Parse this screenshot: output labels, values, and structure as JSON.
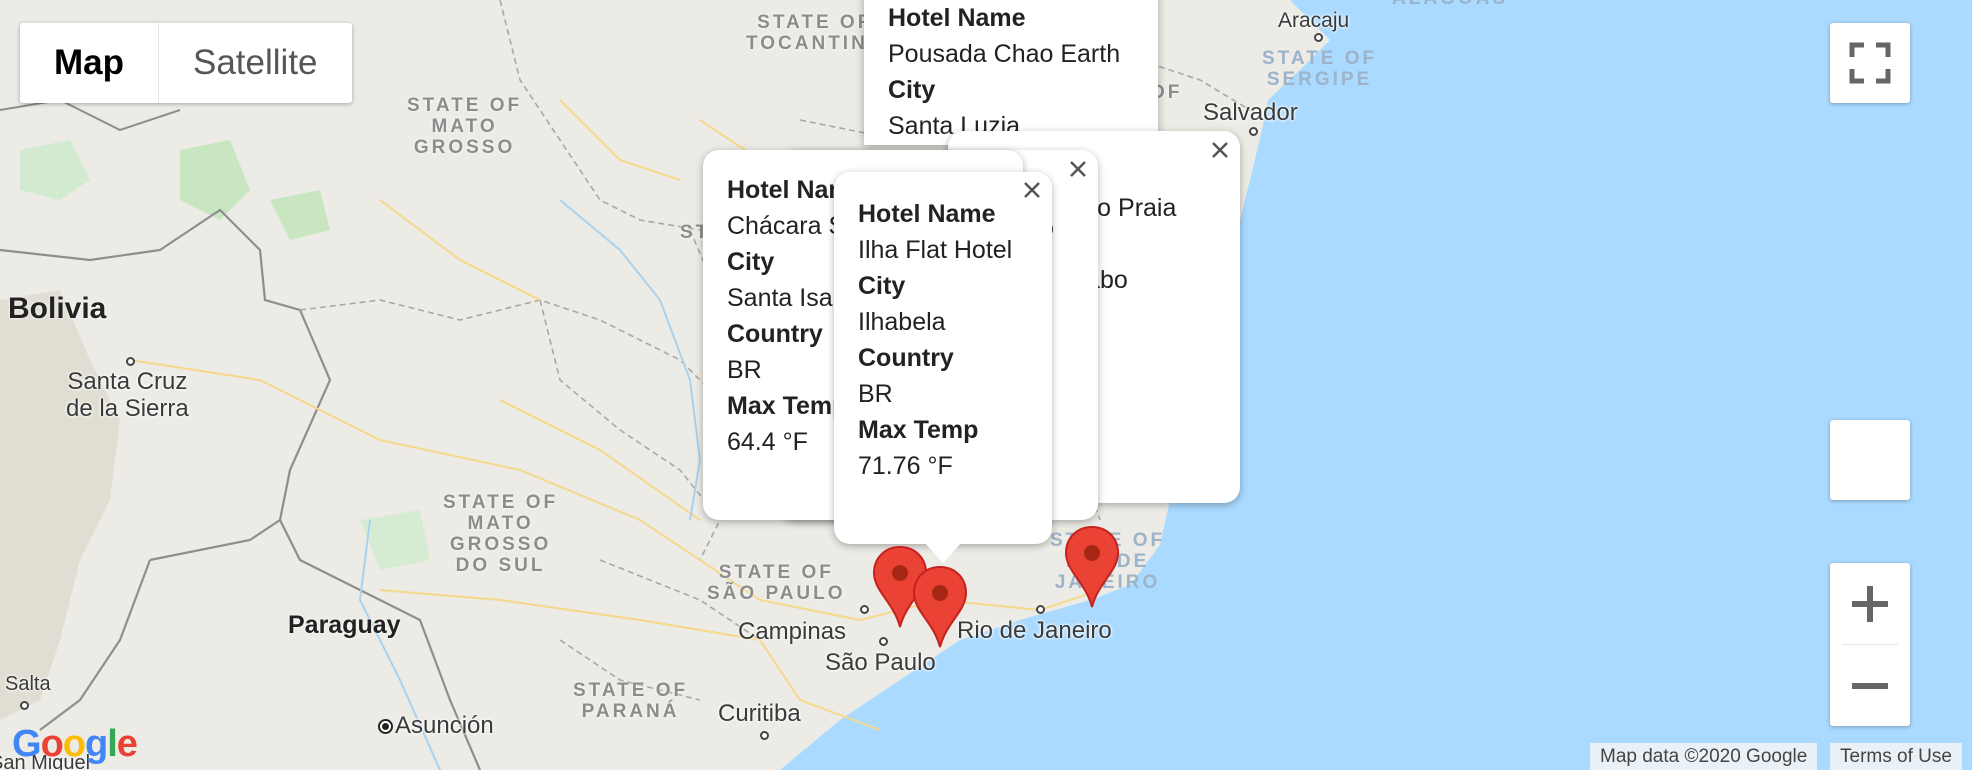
{
  "map_type": {
    "map_label": "Map",
    "satellite_label": "Satellite",
    "active": "Map"
  },
  "countries": {
    "bolivia": "Bolivia",
    "paraguay": "Paraguay"
  },
  "states": {
    "tocantins": [
      "STATE OF",
      "TOCANTINS"
    ],
    "mato_grosso": [
      "STATE OF",
      "MATO",
      "GROSSO"
    ],
    "mato_grosso_do_sul": [
      "STATE OF",
      "MATO",
      "GROSSO",
      "DO SUL"
    ],
    "sao_paulo": [
      "STATE OF",
      "SÃO PAULO"
    ],
    "parana": [
      "STATE OF",
      "PARANÁ"
    ],
    "sergipe": [
      "STATE OF",
      "SERGIPE"
    ],
    "rio_de_janeiro": [
      "STATE OF",
      "RIO DE",
      "JANEIRO"
    ],
    "alagoas": "ALAGOAS",
    "bahia_fragment": "OF"
  },
  "cities": {
    "santa_cruz": [
      "Santa Cruz",
      "de la Sierra"
    ],
    "salta": "Salta",
    "san_miguel": "San Miguel",
    "asuncion": "Asunción",
    "campinas": "Campinas",
    "sao_paulo": "São Paulo",
    "rio_de_janeiro": "Rio de Janeiro",
    "curitiba": "Curitiba",
    "aracaju": "Aracaju",
    "salvador": "Salvador"
  },
  "info_windows": [
    {
      "hotel_label": "Hotel Name",
      "hotel": "Pousada Chao Earth",
      "city_label": "City",
      "city": "Santa Luzia"
    },
    {
      "hotel_label": "Hotel Name",
      "hotel_fragment": "orto Praia",
      "city_fragment": "Cabo",
      "hotel_label_fragment": "e",
      "line2_fragment": "o"
    },
    {
      "hotel_label": "Hotel Name",
      "hotel": "Chácara S",
      "city_label": "City",
      "city": "Santa Isa",
      "country_label": "Country",
      "country": "BR",
      "temp_label": "Max Temp",
      "temp": "64.4 °F"
    },
    {
      "hotel_label": "Hotel Name",
      "hotel": "Ilha Flat Hotel",
      "city_label": "City",
      "city": "Ilhabela",
      "country_label": "Country",
      "country": "BR",
      "temp_label": "Max Temp",
      "temp": "71.76 °F"
    }
  ],
  "markers": [
    {
      "label": "Ilha Flat Hotel marker"
    },
    {
      "label": "second marker"
    },
    {
      "label": "Rio marker"
    }
  ],
  "controls": {
    "fullscreen_icon": "fullscreen-icon",
    "zoom_in_icon": "plus-icon",
    "zoom_out_icon": "minus-icon",
    "close_icon": "close-icon"
  },
  "attribution": {
    "map_data": "Map data ©2020 Google",
    "terms": "Terms of Use",
    "logo": "Google"
  },
  "colors": {
    "water": "#aadaff",
    "land": "#ecebe5",
    "marker": "#ea4335",
    "marker_dark": "#a52714"
  }
}
